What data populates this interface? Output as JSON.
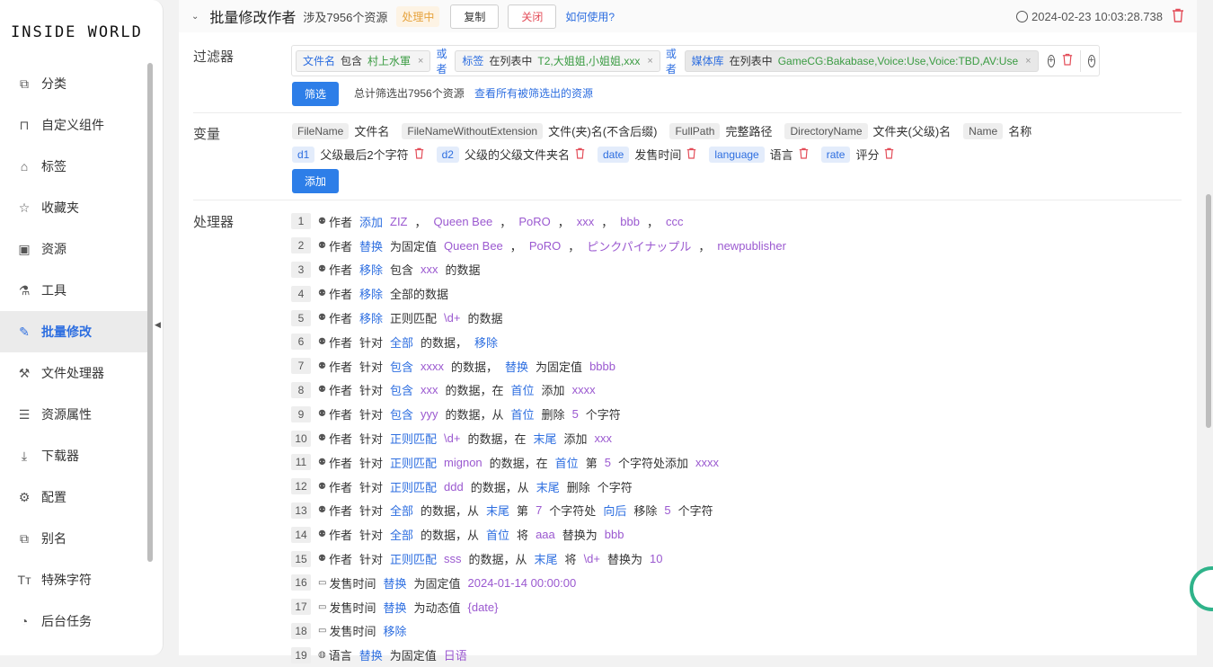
{
  "app": {
    "logo": "INSIDE WORLD"
  },
  "sidebar": {
    "items": [
      {
        "label": "分类",
        "icon": "category-icon"
      },
      {
        "label": "自定义组件",
        "icon": "component-icon"
      },
      {
        "label": "标签",
        "icon": "tag-icon"
      },
      {
        "label": "收藏夹",
        "icon": "star-icon"
      },
      {
        "label": "资源",
        "icon": "image-icon"
      },
      {
        "label": "工具",
        "icon": "flask-icon"
      },
      {
        "label": "批量修改",
        "icon": "brush-icon",
        "active": true
      },
      {
        "label": "文件处理器",
        "icon": "worker-icon"
      },
      {
        "label": "资源属性",
        "icon": "list-icon"
      },
      {
        "label": "下载器",
        "icon": "download-icon"
      },
      {
        "label": "配置",
        "icon": "gear-icon"
      },
      {
        "label": "别名",
        "icon": "copy-icon"
      },
      {
        "label": "特殊字符",
        "icon": "text-size-icon"
      },
      {
        "label": "后台任务",
        "icon": "cookie-icon"
      }
    ]
  },
  "header": {
    "title": "批量修改作者",
    "scope": "涉及7956个资源",
    "status": "处理中",
    "copy_label": "复制",
    "close_label": "关闭",
    "help_label": "如何使用?",
    "timestamp": "2024-02-23 10:03:28.738"
  },
  "filter": {
    "label": "过滤器",
    "chips": [
      {
        "prop": "文件名",
        "op": "包含",
        "value": "村上水軍"
      },
      {
        "prop": "标签",
        "op": "在列表中",
        "value": "T2,大姐姐,小姐姐,xxx"
      },
      {
        "prop": "媒体库",
        "op": "在列表中",
        "value": "GameCG:Bakabase,Voice:Use,Voice:TBD,AV:Use"
      }
    ],
    "or_label": "或者",
    "filter_button": "筛选",
    "summary": "总计筛选出7956个资源",
    "view_all_link": "查看所有被筛选出的资源"
  },
  "variables": {
    "label": "变量",
    "builtin": [
      {
        "key": "FileName",
        "desc": "文件名"
      },
      {
        "key": "FileNameWithoutExtension",
        "desc": "文件(夹)名(不含后缀)"
      },
      {
        "key": "FullPath",
        "desc": "完整路径"
      },
      {
        "key": "DirectoryName",
        "desc": "文件夹(父级)名"
      },
      {
        "key": "Name",
        "desc": "名称"
      }
    ],
    "custom": [
      {
        "key": "d1",
        "desc": "父级最后2个字符"
      },
      {
        "key": "d2",
        "desc": "父级的父级文件夹名"
      },
      {
        "key": "date",
        "desc": "发售时间"
      },
      {
        "key": "language",
        "desc": "语言"
      },
      {
        "key": "rate",
        "desc": "评分"
      }
    ],
    "add_button": "添加"
  },
  "processors": {
    "label": "处理器",
    "rows": [
      {
        "n": "1",
        "icon": "users-icon",
        "tokens": [
          [
            "prop",
            "作者"
          ],
          [
            "op",
            "添加"
          ],
          [
            "val",
            "ZIZ"
          ],
          [
            "comma",
            "，"
          ],
          [
            "val",
            "Queen Bee"
          ],
          [
            "comma",
            "，"
          ],
          [
            "val",
            "PoRO"
          ],
          [
            "comma",
            "，"
          ],
          [
            "val",
            "xxx"
          ],
          [
            "comma",
            "，"
          ],
          [
            "val",
            "bbb"
          ],
          [
            "comma",
            "，"
          ],
          [
            "val",
            "ccc"
          ]
        ]
      },
      {
        "n": "2",
        "icon": "users-icon",
        "tokens": [
          [
            "prop",
            "作者"
          ],
          [
            "op",
            "替换"
          ],
          [
            "txt",
            "为固定值"
          ],
          [
            "val",
            "Queen Bee"
          ],
          [
            "comma",
            "，"
          ],
          [
            "val",
            "PoRO"
          ],
          [
            "comma",
            "，"
          ],
          [
            "val",
            "ピンクパイナップル"
          ],
          [
            "comma",
            "，"
          ],
          [
            "val",
            "newpublisher"
          ]
        ]
      },
      {
        "n": "3",
        "icon": "users-icon",
        "tokens": [
          [
            "prop",
            "作者"
          ],
          [
            "op",
            "移除"
          ],
          [
            "txt",
            "包含"
          ],
          [
            "val",
            "xxx"
          ],
          [
            "txt",
            "的数据"
          ]
        ]
      },
      {
        "n": "4",
        "icon": "users-icon",
        "tokens": [
          [
            "prop",
            "作者"
          ],
          [
            "op",
            "移除"
          ],
          [
            "txt",
            "全部的数据"
          ]
        ]
      },
      {
        "n": "5",
        "icon": "users-icon",
        "tokens": [
          [
            "prop",
            "作者"
          ],
          [
            "op",
            "移除"
          ],
          [
            "txt",
            "正则匹配"
          ],
          [
            "val",
            "\\d+"
          ],
          [
            "txt",
            "的数据"
          ]
        ]
      },
      {
        "n": "6",
        "icon": "users-icon",
        "tokens": [
          [
            "prop",
            "作者"
          ],
          [
            "txt",
            "针对"
          ],
          [
            "op",
            "全部"
          ],
          [
            "txt",
            "的数据，"
          ],
          [
            "op",
            "移除"
          ]
        ]
      },
      {
        "n": "7",
        "icon": "users-icon",
        "tokens": [
          [
            "prop",
            "作者"
          ],
          [
            "txt",
            "针对"
          ],
          [
            "op",
            "包含"
          ],
          [
            "val",
            "xxxx"
          ],
          [
            "txt",
            "的数据，"
          ],
          [
            "op",
            "替换"
          ],
          [
            "txt",
            "为固定值"
          ],
          [
            "val",
            "bbbb"
          ]
        ]
      },
      {
        "n": "8",
        "icon": "users-icon",
        "tokens": [
          [
            "prop",
            "作者"
          ],
          [
            "txt",
            "针对"
          ],
          [
            "op",
            "包含"
          ],
          [
            "val",
            "xxx"
          ],
          [
            "txt",
            "的数据，在"
          ],
          [
            "op",
            "首位"
          ],
          [
            "txt",
            "添加"
          ],
          [
            "val",
            "xxxx"
          ]
        ]
      },
      {
        "n": "9",
        "icon": "users-icon",
        "tokens": [
          [
            "prop",
            "作者"
          ],
          [
            "txt",
            "针对"
          ],
          [
            "op",
            "包含"
          ],
          [
            "val",
            "yyy"
          ],
          [
            "txt",
            "的数据，从"
          ],
          [
            "op",
            "首位"
          ],
          [
            "txt",
            "删除"
          ],
          [
            "val",
            "5"
          ],
          [
            "txt",
            "个字符"
          ]
        ]
      },
      {
        "n": "10",
        "icon": "users-icon",
        "tokens": [
          [
            "prop",
            "作者"
          ],
          [
            "txt",
            "针对"
          ],
          [
            "op",
            "正则匹配"
          ],
          [
            "val",
            "\\d+"
          ],
          [
            "txt",
            "的数据，在"
          ],
          [
            "op",
            "末尾"
          ],
          [
            "txt",
            "添加"
          ],
          [
            "val",
            "xxx"
          ]
        ]
      },
      {
        "n": "11",
        "icon": "users-icon",
        "tokens": [
          [
            "prop",
            "作者"
          ],
          [
            "txt",
            "针对"
          ],
          [
            "op",
            "正则匹配"
          ],
          [
            "val",
            "mignon"
          ],
          [
            "txt",
            "的数据，在"
          ],
          [
            "op",
            "首位"
          ],
          [
            "txt",
            "第"
          ],
          [
            "val",
            "5"
          ],
          [
            "txt",
            "个字符处添加"
          ],
          [
            "val",
            "xxxx"
          ]
        ]
      },
      {
        "n": "12",
        "icon": "users-icon",
        "tokens": [
          [
            "prop",
            "作者"
          ],
          [
            "txt",
            "针对"
          ],
          [
            "op",
            "正则匹配"
          ],
          [
            "val",
            "ddd"
          ],
          [
            "txt",
            "的数据，从"
          ],
          [
            "op",
            "末尾"
          ],
          [
            "txt",
            "删除"
          ],
          [
            "txt",
            "  个字符"
          ]
        ]
      },
      {
        "n": "13",
        "icon": "users-icon",
        "tokens": [
          [
            "prop",
            "作者"
          ],
          [
            "txt",
            "针对"
          ],
          [
            "op",
            "全部"
          ],
          [
            "txt",
            "的数据，从"
          ],
          [
            "op",
            "末尾"
          ],
          [
            "txt",
            "第"
          ],
          [
            "val",
            "7"
          ],
          [
            "txt",
            "个字符处"
          ],
          [
            "op",
            "向后"
          ],
          [
            "txt",
            "移除"
          ],
          [
            "val",
            "5"
          ],
          [
            "txt",
            "个字符"
          ]
        ]
      },
      {
        "n": "14",
        "icon": "users-icon",
        "tokens": [
          [
            "prop",
            "作者"
          ],
          [
            "txt",
            "针对"
          ],
          [
            "op",
            "全部"
          ],
          [
            "txt",
            "的数据，从"
          ],
          [
            "op",
            "首位"
          ],
          [
            "txt",
            "将"
          ],
          [
            "val",
            "aaa"
          ],
          [
            "txt",
            "替换为"
          ],
          [
            "val",
            "bbb"
          ]
        ]
      },
      {
        "n": "15",
        "icon": "users-icon",
        "tokens": [
          [
            "prop",
            "作者"
          ],
          [
            "txt",
            "针对"
          ],
          [
            "op",
            "正则匹配"
          ],
          [
            "val",
            "sss"
          ],
          [
            "txt",
            "的数据，从"
          ],
          [
            "op",
            "末尾"
          ],
          [
            "txt",
            "将"
          ],
          [
            "val",
            "\\d+"
          ],
          [
            "txt",
            "替换为"
          ],
          [
            "val",
            "10"
          ]
        ]
      },
      {
        "n": "16",
        "icon": "calendar-icon",
        "tokens": [
          [
            "prop",
            "发售时间"
          ],
          [
            "op",
            "替换"
          ],
          [
            "txt",
            "为固定值"
          ],
          [
            "val",
            "2024-01-14 00:00:00"
          ]
        ]
      },
      {
        "n": "17",
        "icon": "calendar-icon",
        "tokens": [
          [
            "prop",
            "发售时间"
          ],
          [
            "op",
            "替换"
          ],
          [
            "txt",
            "为动态值"
          ],
          [
            "val",
            "{date}"
          ]
        ]
      },
      {
        "n": "18",
        "icon": "calendar-icon",
        "tokens": [
          [
            "prop",
            "发售时间"
          ],
          [
            "op",
            "移除"
          ]
        ]
      },
      {
        "n": "19",
        "icon": "globe-icon",
        "tokens": [
          [
            "prop",
            "语言"
          ],
          [
            "op",
            "替换"
          ],
          [
            "txt",
            "为固定值"
          ],
          [
            "val",
            "日语"
          ]
        ]
      }
    ]
  }
}
